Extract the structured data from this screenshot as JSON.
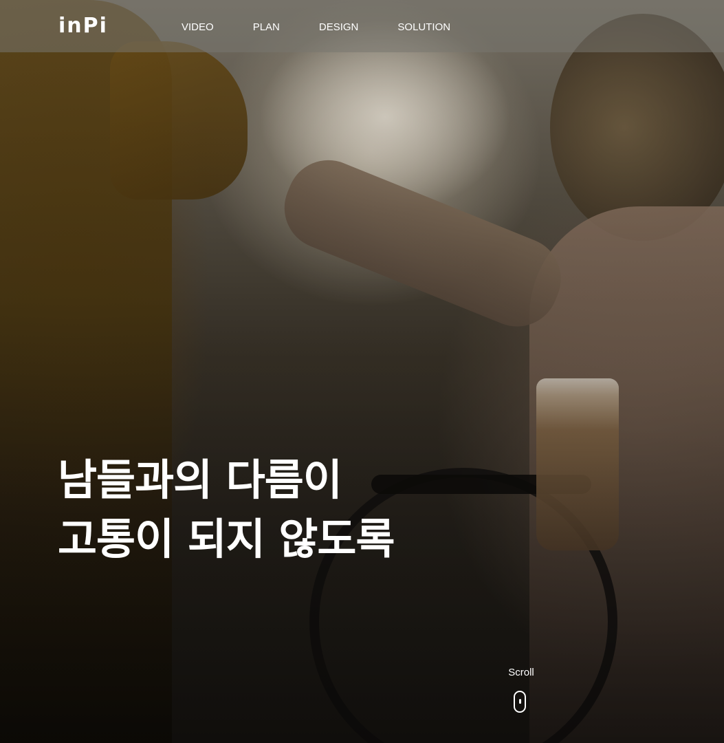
{
  "header": {
    "logo_text": "inPi",
    "nav": [
      {
        "label": "VIDEO"
      },
      {
        "label": "PLAN"
      },
      {
        "label": "DESIGN"
      },
      {
        "label": "SOLUTION"
      }
    ]
  },
  "hero": {
    "headline_line1": "남들과의 다름이",
    "headline_line2": "고통이 되지 않도록",
    "background": "photo of a person in a wheelchair holding a coffee cup, reaching up to another person at sunset"
  },
  "scroll": {
    "label": "Scroll",
    "icon": "mouse-scroll-icon"
  },
  "colors": {
    "text": "#ffffff",
    "header_overlay": "rgba(120,118,112,0.55)"
  }
}
